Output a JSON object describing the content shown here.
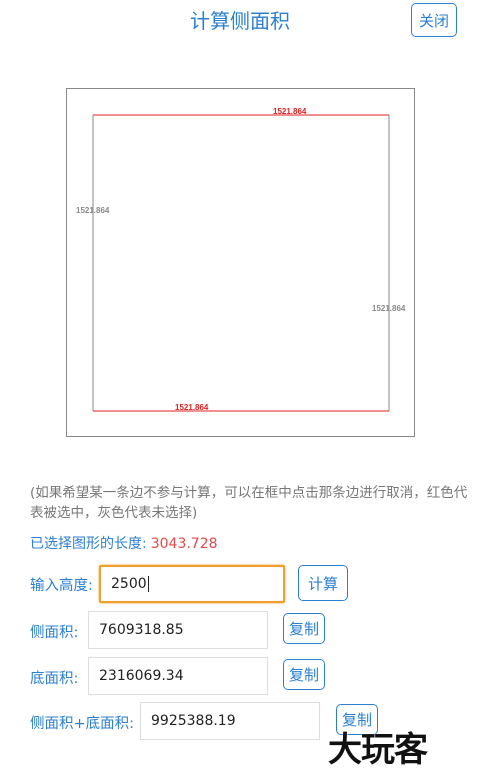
{
  "header": {
    "title": "计算侧面积",
    "close_label": "关闭"
  },
  "canvas": {
    "edges": {
      "top": "1521.864",
      "left": "1521.864",
      "right": "1521.864",
      "bottom": "1521.864"
    },
    "colors": {
      "selected": "#e02020",
      "unselected": "#888888"
    }
  },
  "hint": "(如果希望某一条边不参与计算，可以在框中点击那条边进行取消，红色代表被选中，灰色代表未选择)",
  "selection": {
    "label": "已选择图形的长度:",
    "value": "3043.728"
  },
  "height_input": {
    "label": "输入高度:",
    "value": "2500",
    "calc_label": "计算"
  },
  "results": {
    "side_area_label": "侧面积:",
    "side_area_value": "7609318.85",
    "base_area_label": "底面积:",
    "base_area_value": "2316069.34",
    "total_label": "侧面积+底面积:",
    "total_value": "9925388.19",
    "copy_label": "复制"
  },
  "watermark": "大玩客",
  "accent_color": "#2b7fd0"
}
